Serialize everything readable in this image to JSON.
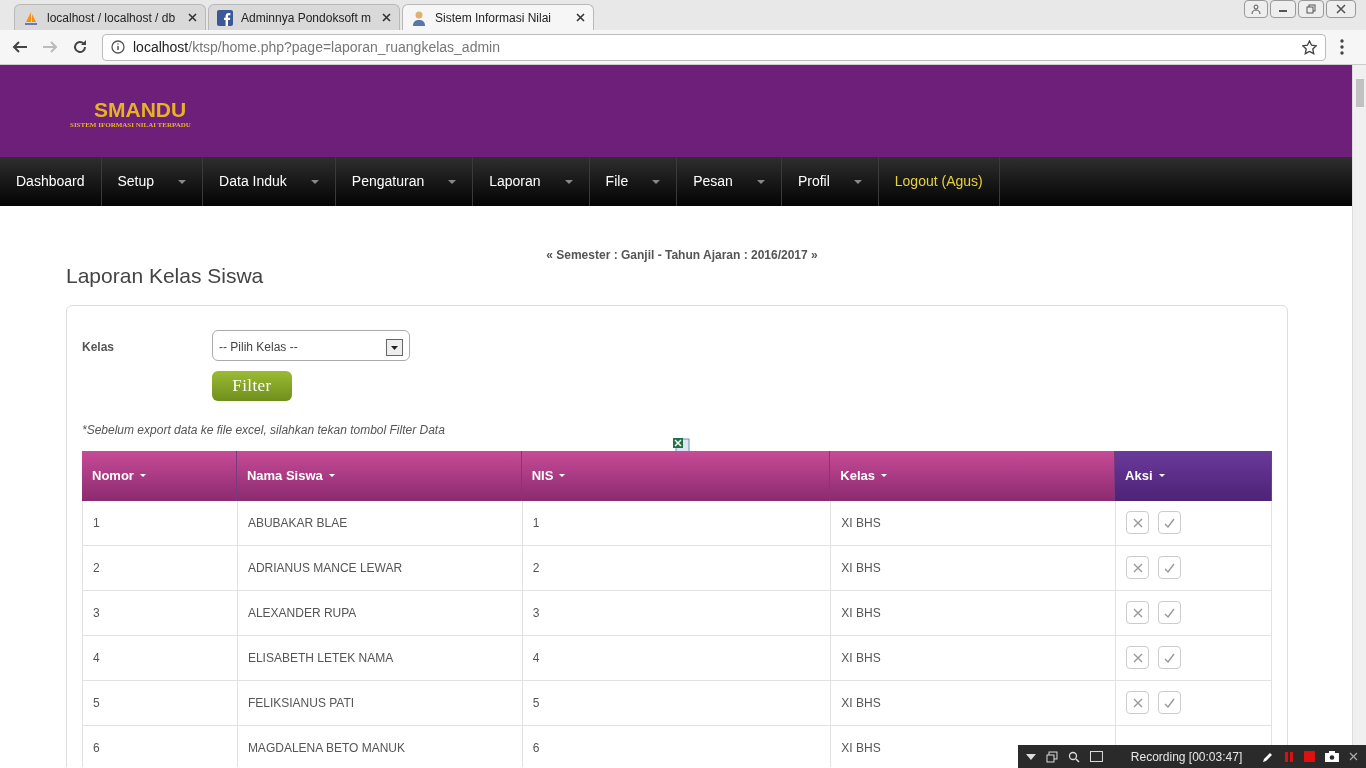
{
  "browser": {
    "tabs": [
      {
        "title": "localhost / localhost / db",
        "selected": false
      },
      {
        "title": "Adminnya Pondoksoft m",
        "selected": false
      },
      {
        "title": "Sistem Informasi Nilai",
        "selected": true
      }
    ],
    "url_host": "localhost",
    "url_path": "/ktsp/home.php?page=laporan_ruangkelas_admin"
  },
  "header": {
    "logo": "SMANDU",
    "tagline": "SISTEM IFORMASI NILAI TERPADU"
  },
  "nav": [
    {
      "label": "Dashboard",
      "dropdown": false,
      "kind": "normal"
    },
    {
      "label": "Setup",
      "dropdown": true,
      "kind": "normal"
    },
    {
      "label": "Data Induk",
      "dropdown": true,
      "kind": "normal"
    },
    {
      "label": "Pengaturan",
      "dropdown": true,
      "kind": "normal"
    },
    {
      "label": "Laporan",
      "dropdown": true,
      "kind": "normal"
    },
    {
      "label": "File",
      "dropdown": true,
      "kind": "normal"
    },
    {
      "label": "Pesan",
      "dropdown": true,
      "kind": "normal"
    },
    {
      "label": "Profil",
      "dropdown": true,
      "kind": "normal"
    },
    {
      "label": "Logout (Agus)",
      "dropdown": false,
      "kind": "logout"
    }
  ],
  "semester": "« Semester : Ganjil - Tahun Ajaran : 2016/2017 »",
  "page_title": "Laporan Kelas Siswa",
  "form": {
    "label": "Kelas",
    "select_value": "-- Pilih Kelas --",
    "button": "Filter",
    "note": "*Sebelum export data ke file excel, silahkan tekan tombol Filter Data"
  },
  "table": {
    "columns": [
      "Nomor",
      "Nama Siswa",
      "NIS",
      "Kelas",
      "Aksi"
    ],
    "rows": [
      [
        "1",
        "ABUBAKAR BLAE",
        "1",
        "XI BHS"
      ],
      [
        "2",
        "ADRIANUS MANCE LEWAR",
        "2",
        "XI BHS"
      ],
      [
        "3",
        "ALEXANDER RUPA",
        "3",
        "XI BHS"
      ],
      [
        "4",
        "ELISABETH LETEK NAMA",
        "4",
        "XI BHS"
      ],
      [
        "5",
        "FELIKSIANUS PATI",
        "5",
        "XI BHS"
      ],
      [
        "6",
        "MAGDALENA BETO MANUK",
        "6",
        "XI BHS"
      ]
    ]
  },
  "recorder": {
    "status": "Recording [00:03:47]"
  }
}
